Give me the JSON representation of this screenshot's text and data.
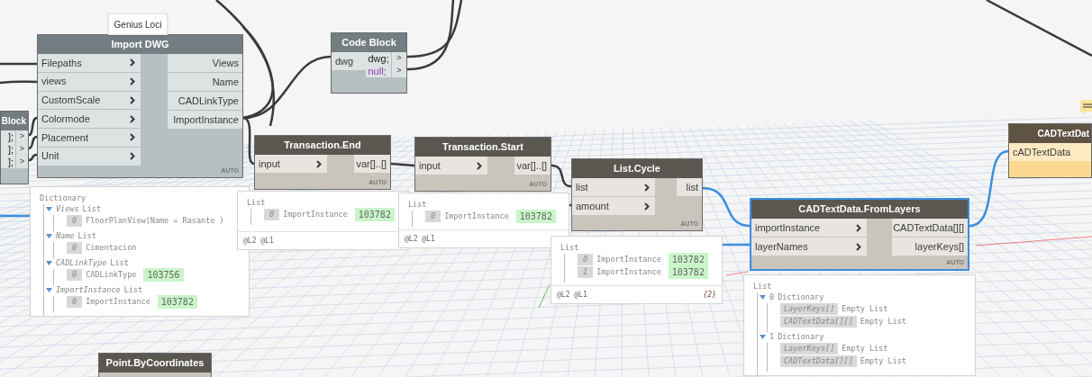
{
  "tooltip": {
    "text": "Genius Loci"
  },
  "nodes": [
    {
      "kind": "function",
      "title": "Import DWG",
      "frozen": true,
      "warning": false,
      "selected": false,
      "inputs": [
        "Filepaths",
        "views",
        "CustomScale",
        "Colormode",
        "Placement",
        "Unit"
      ],
      "outputs": [
        "Views",
        "Name",
        "CADLinkType",
        "ImportInstance"
      ],
      "lacing": "AUTO"
    },
    {
      "kind": "code",
      "title": "Block",
      "frozen": true,
      "warning": false,
      "selected": false,
      "lines": [
        {
          "text": "];",
          "literal": false
        },
        {
          "text": "];",
          "literal": false
        },
        {
          "text": "];",
          "literal": false
        }
      ],
      "outputs": [
        ">",
        ">",
        ">"
      ]
    },
    {
      "kind": "code",
      "title": "Code Block",
      "frozen": true,
      "warning": false,
      "selected": false,
      "inputs": [
        "dwg"
      ],
      "lines": [
        {
          "text": "dwg;",
          "literal": false
        },
        {
          "text": "null;",
          "literal": true
        }
      ],
      "outputs": [
        ">",
        ">"
      ]
    },
    {
      "kind": "function",
      "title": "Transaction.End",
      "frozen": false,
      "warning": false,
      "selected": false,
      "inputs": [
        "input"
      ],
      "outputs": [
        "var[]..[]"
      ],
      "lacing": "AUTO"
    },
    {
      "kind": "function",
      "title": "Transaction.Start",
      "frozen": false,
      "warning": false,
      "selected": false,
      "inputs": [
        "input"
      ],
      "outputs": [
        "var[]..[]"
      ],
      "lacing": "AUTO"
    },
    {
      "kind": "function",
      "title": "List.Cycle",
      "frozen": false,
      "warning": false,
      "selected": false,
      "inputs": [
        "list",
        "amount"
      ],
      "outputs": [
        "list"
      ],
      "lacing": "AUTO"
    },
    {
      "kind": "function",
      "title": "CADTextData.FromLayers",
      "frozen": false,
      "warning": false,
      "selected": true,
      "inputs": [
        "importInstance",
        "layerNames"
      ],
      "outputs": [
        "CADTextData[][]",
        "layerKeys[]"
      ],
      "lacing": "AUTO"
    },
    {
      "kind": "function",
      "title": "CADTextDat",
      "warning": true,
      "selected": false,
      "inputs": [
        "cADTextData"
      ]
    },
    {
      "kind": "function",
      "title": "Point.ByCoordinates",
      "frozen": false,
      "warning": false,
      "selected": false
    }
  ],
  "previews": [
    {
      "title": "Dictionary",
      "items": [
        {
          "key": "Views",
          "label": "List",
          "expanded": true,
          "children": [
            {
              "index": "0",
              "label": "FloorPlanView(Name = Rasante )"
            }
          ]
        },
        {
          "key": "Name",
          "label": "List",
          "expanded": true,
          "children": [
            {
              "index": "0",
              "label": "Cimentacion"
            }
          ]
        },
        {
          "key": "CADLinkType",
          "label": "List",
          "expanded": true,
          "children": [
            {
              "index": "0",
              "label": "CADLinkType",
              "value": "103756"
            }
          ]
        },
        {
          "key": "ImportInstance",
          "label": "List",
          "expanded": true,
          "children": [
            {
              "index": "0",
              "label": "ImportInstance",
              "value": "103782"
            }
          ]
        }
      ]
    },
    {
      "title": "List",
      "items": [
        {
          "index": "0",
          "label": "ImportInstance",
          "value": "103782"
        }
      ],
      "levels": "@L2 @L1"
    },
    {
      "title": "List",
      "items": [
        {
          "index": "0",
          "label": "ImportInstance",
          "value": "103782"
        }
      ],
      "levels": "@L2 @L1"
    },
    {
      "title": "List",
      "items": [
        {
          "index": "0",
          "label": "ImportInstance",
          "value": "103782"
        },
        {
          "index": "1",
          "label": "ImportInstance",
          "value": "103782"
        }
      ],
      "levels": "@L2 @L1",
      "count": "{2}"
    },
    {
      "title": "List",
      "items": [
        {
          "index": "0",
          "label": "Dictionary",
          "expanded": true,
          "children": [
            {
              "key": "LayerKeys[]",
              "label": "Empty List"
            },
            {
              "key": "CADTextData[][]",
              "label": "Empty List"
            }
          ]
        },
        {
          "index": "1",
          "label": "Dictionary",
          "expanded": true,
          "children": [
            {
              "key": "LayerKeys[]",
              "label": "Empty List"
            },
            {
              "key": "CADTextData[][]",
              "label": "Empty List"
            }
          ]
        }
      ]
    }
  ]
}
